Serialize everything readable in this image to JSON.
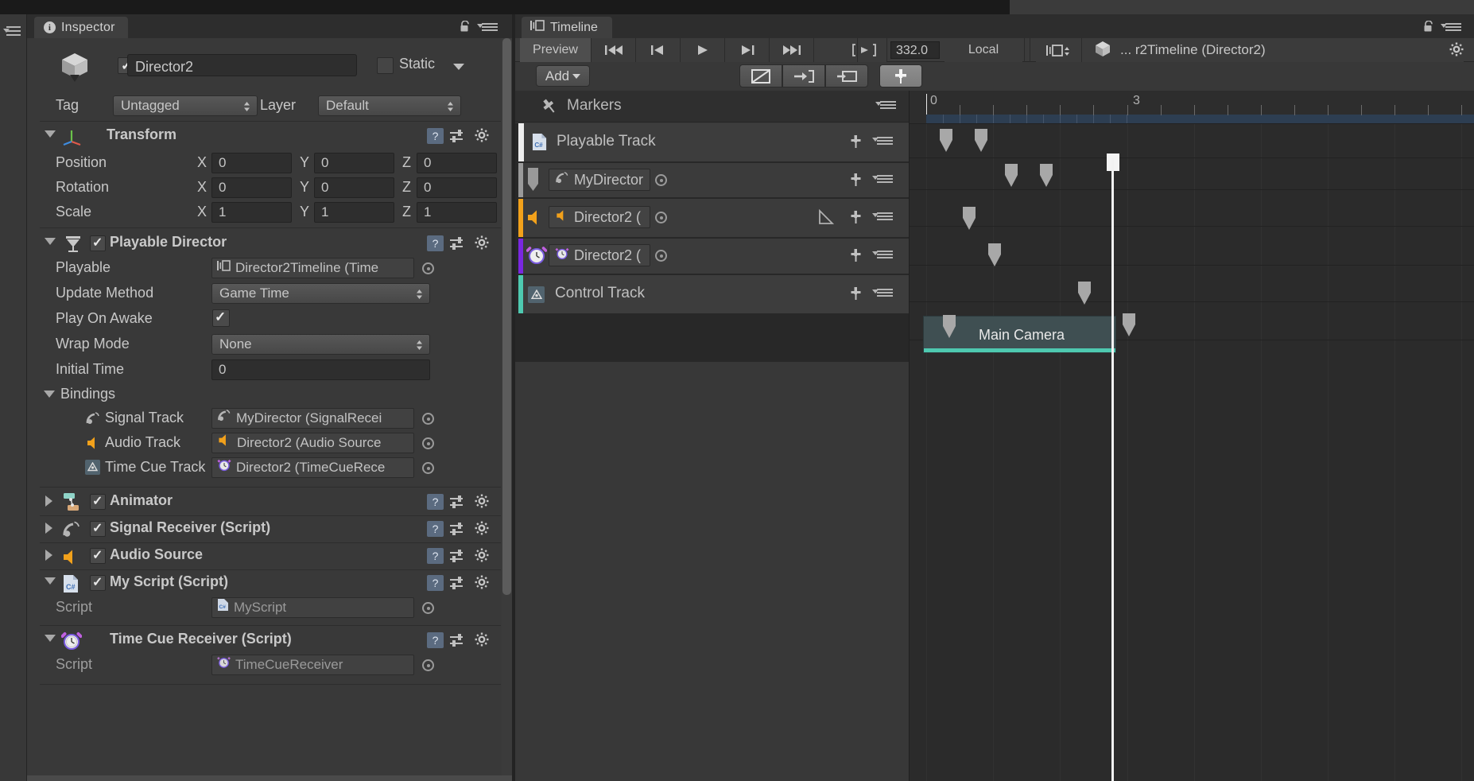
{
  "window": {
    "inspector_tab": "Inspector",
    "timeline_tab": "Timeline"
  },
  "inspector": {
    "game_object": {
      "name_value": "Director2",
      "enabled": true,
      "static_label": "Static",
      "tag_label": "Tag",
      "tag_value": "Untagged",
      "layer_label": "Layer",
      "layer_value": "Default"
    },
    "transform": {
      "title": "Transform",
      "rows": [
        {
          "label": "Position",
          "x": "0",
          "y": "0",
          "z": "0"
        },
        {
          "label": "Rotation",
          "x": "0",
          "y": "0",
          "z": "0"
        },
        {
          "label": "Scale",
          "x": "1",
          "y": "1",
          "z": "1"
        }
      ],
      "axis_x": "X",
      "axis_y": "Y",
      "axis_z": "Z"
    },
    "playable_director": {
      "title": "Playable Director",
      "enabled": true,
      "playable_label": "Playable",
      "playable_value": "Director2Timeline (Time",
      "update_method_label": "Update Method",
      "update_method_value": "Game Time",
      "play_on_awake_label": "Play On Awake",
      "play_on_awake_value": true,
      "wrap_mode_label": "Wrap Mode",
      "wrap_mode_value": "None",
      "initial_time_label": "Initial Time",
      "initial_time_value": "0",
      "bindings_label": "Bindings",
      "bindings": [
        {
          "label": "Signal Track",
          "value": "MyDirector (SignalRecei",
          "icon": "signal-receiver-icon"
        },
        {
          "label": "Audio Track",
          "value": "Director2 (Audio Source",
          "icon": "audio-source-icon"
        },
        {
          "label": "Time Cue Track",
          "value": "Director2 (TimeCueRece",
          "icon": "alarm-clock-icon"
        }
      ]
    },
    "components": [
      {
        "title": "Animator",
        "enabled": true,
        "expanded": false,
        "icon": "animator-icon"
      },
      {
        "title": "Signal Receiver (Script)",
        "enabled": true,
        "expanded": false,
        "icon": "signal-receiver-icon"
      },
      {
        "title": "Audio Source",
        "enabled": true,
        "expanded": false,
        "icon": "audio-source-icon"
      },
      {
        "title": "My Script (Script)",
        "enabled": true,
        "expanded": true,
        "icon": "csharp-icon"
      },
      {
        "title": "Time Cue Receiver (Script)",
        "enabled": null,
        "expanded": true,
        "icon": "alarm-clock-icon"
      }
    ],
    "script_rows": [
      {
        "label": "Script",
        "value": "MyScript",
        "icon": "csharp-icon"
      },
      {
        "label": "Script",
        "value": "TimeCueReceiver",
        "icon": "alarm-clock-icon"
      }
    ]
  },
  "timeline": {
    "toolbar": {
      "preview_label": "Preview",
      "buttons": [
        {
          "name": "go-to-start-button",
          "glyph": "skip-to-start-icon"
        },
        {
          "name": "previous-frame-button",
          "glyph": "step-back-icon"
        },
        {
          "name": "play-button",
          "glyph": "play-icon"
        },
        {
          "name": "next-frame-button",
          "glyph": "step-forward-icon"
        },
        {
          "name": "go-to-end-button",
          "glyph": "skip-to-end-icon"
        },
        {
          "name": "play-range-button",
          "glyph": "play-range-icon"
        }
      ],
      "time_field_value": "332.0",
      "mode_label": "Local",
      "timeline_selector": "... r2Timeline (Director2)"
    },
    "add_button_label": "Add",
    "markers_label": "Markers",
    "tracks": [
      {
        "name": "Playable Track",
        "accent": "#d8d8d8",
        "icon": "csharp-icon",
        "has_binding": false,
        "binding": ""
      },
      {
        "name": "",
        "accent": "#9a9a9a",
        "icon": "signal-receiver-icon",
        "has_binding": true,
        "binding": "MyDirector"
      },
      {
        "name": "",
        "accent": "#f2a11b",
        "icon": "audio-source-icon",
        "has_binding": true,
        "binding": "Director2 ("
      },
      {
        "name": "",
        "accent": "#7a27e0",
        "icon": "alarm-clock-icon",
        "has_binding": true,
        "binding": "Director2 ("
      },
      {
        "name": "Control Track",
        "accent": "#4ec9b0",
        "icon": "control-track-icon",
        "has_binding": false,
        "binding": ""
      }
    ],
    "ruler": {
      "labels": [
        "0",
        "3"
      ]
    },
    "clips": [
      {
        "track": "Control Track",
        "label": "Main Camera",
        "color": "#4ec9b0"
      }
    ]
  },
  "colors": {
    "panel_bg": "#393939",
    "timeline_bg": "#383838",
    "accent_orange": "#f2a11b",
    "accent_purple": "#7a27e0",
    "accent_teal": "#4ec9b0",
    "ruler_band": "#2d3e52"
  }
}
